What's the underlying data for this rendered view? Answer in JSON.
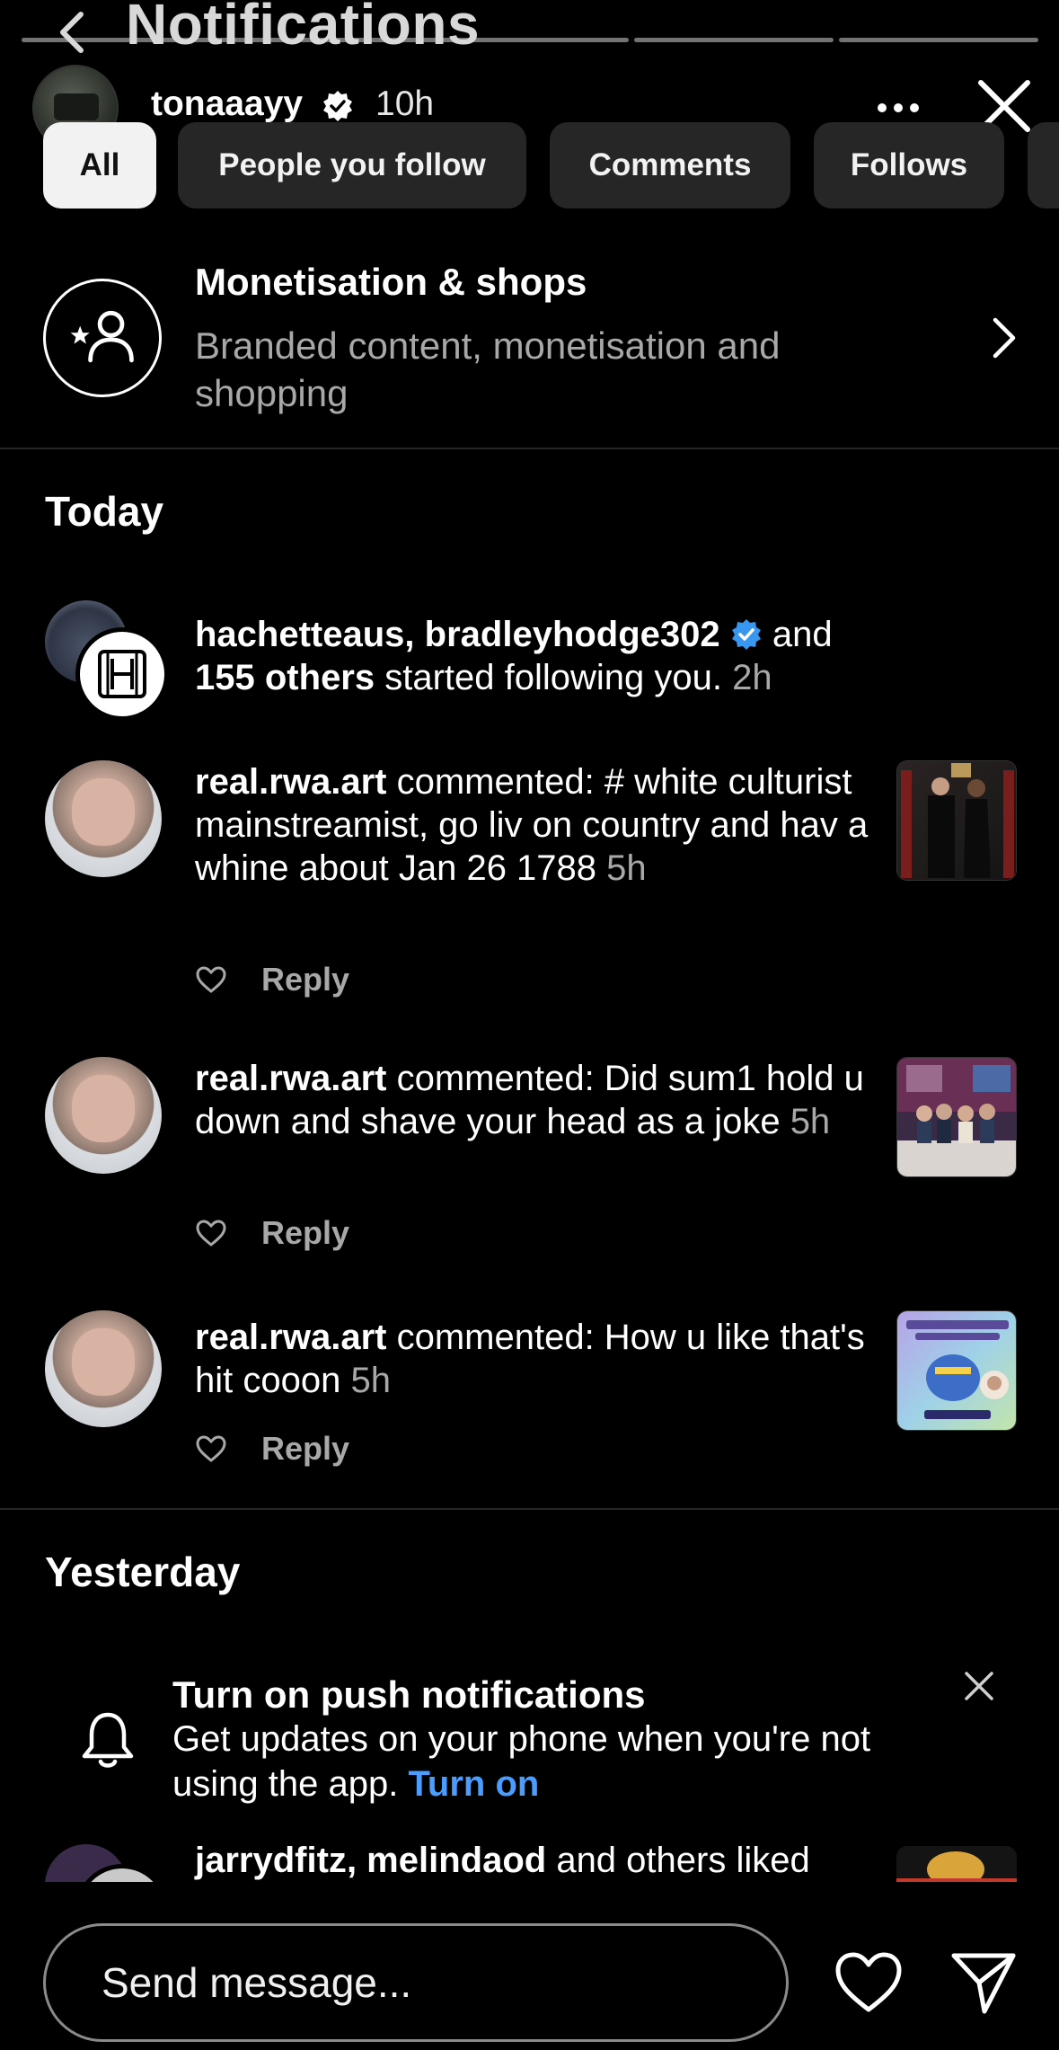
{
  "header": {
    "background_title": "Notifications",
    "story": {
      "username": "tonaaayy",
      "time": "10h",
      "progress_segments": 4
    }
  },
  "filters": {
    "chips": [
      {
        "label": "All",
        "active": true
      },
      {
        "label": "People you follow",
        "active": false
      },
      {
        "label": "Comments",
        "active": false
      },
      {
        "label": "Follows",
        "active": false
      }
    ]
  },
  "monetisation": {
    "title": "Monetisation & shops",
    "subtitle": "Branded content, monetisation and shopping"
  },
  "sections": {
    "today": "Today",
    "yesterday": "Yesterday"
  },
  "follow_notification": {
    "user1": "hachetteaus",
    "sep": ", ",
    "user2": "bradleyhodge302",
    "and": " and ",
    "count": "155",
    "others": "others",
    "action": " started following you.",
    "time": "2h"
  },
  "comments": [
    {
      "user": "real.rwa.art",
      "action": " commented: ",
      "text": "# white culturist mainstreamist,  go liv on country and hav a whine about Jan 26 1788",
      "time": "5h",
      "reply_label": "Reply"
    },
    {
      "user": "real.rwa.art",
      "action": " commented: ",
      "text": "Did sum1 hold u down and shave your head as a joke",
      "time": "5h",
      "reply_label": "Reply"
    },
    {
      "user": "real.rwa.art",
      "action": " commented: ",
      "text": "How u like that's hit cooon",
      "time": "5h",
      "reply_label": "Reply"
    }
  ],
  "push_prompt": {
    "title": "Turn on push notifications",
    "body": "Get updates on your phone when you're not using the app.",
    "link": "Turn on"
  },
  "liked_notification": {
    "user1": "jarrydfitz",
    "sep": ", ",
    "user2": "melindaod",
    "rest": " and others liked"
  },
  "message_bar": {
    "placeholder": "Send message..."
  },
  "colors": {
    "background": "#000000",
    "link_blue": "#4a9cff",
    "verified_blue": "#3897f0",
    "muted_text": "#a8a8a8",
    "chip_bg": "#262626"
  }
}
